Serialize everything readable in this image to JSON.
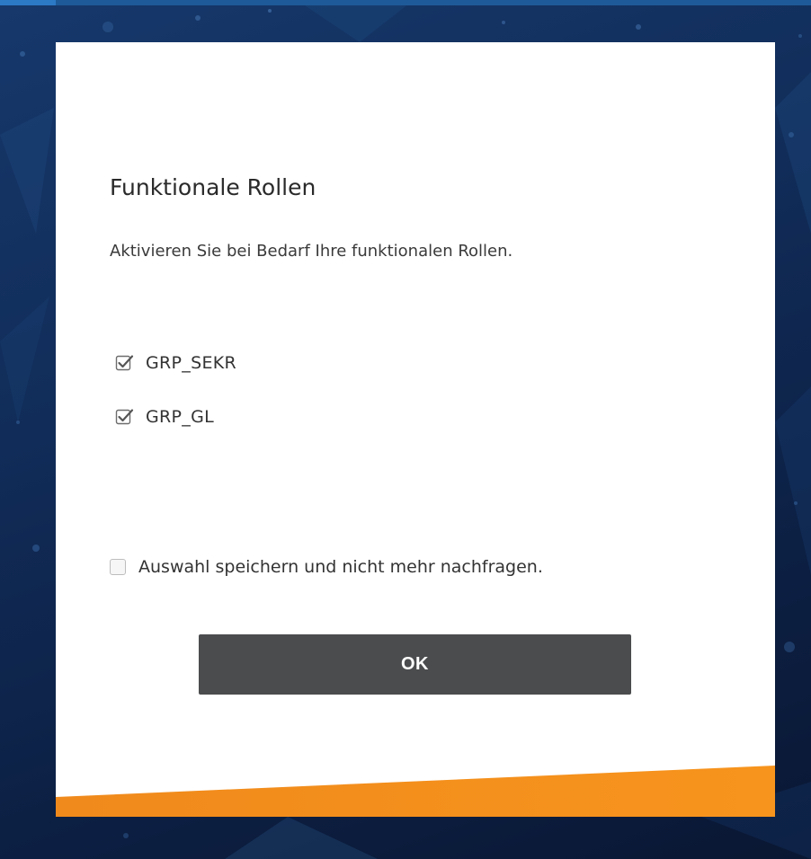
{
  "dialog": {
    "title": "Funktionale Rollen",
    "description": "Aktivieren Sie bei Bedarf Ihre funktionalen Rollen.",
    "roles": [
      {
        "label": "GRP_SEKR",
        "checked": true
      },
      {
        "label": "GRP_GL",
        "checked": true
      }
    ],
    "remember": {
      "label": "Auswahl speichern und nicht mehr nachfragen.",
      "checked": false
    },
    "ok_label": "OK"
  },
  "colors": {
    "background": "#102a55",
    "button": "#4b4c4e",
    "accent_orange": "#f7941d",
    "text": "#333333"
  },
  "icons": {
    "role_check": "checkmark-icon"
  }
}
